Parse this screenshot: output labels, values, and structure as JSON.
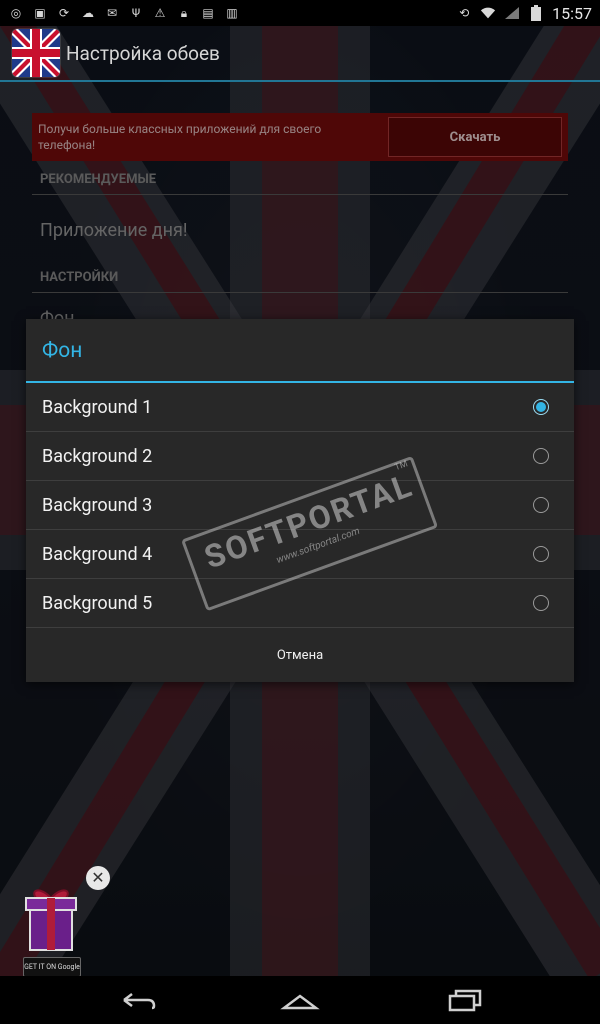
{
  "status_bar": {
    "time": "15:57",
    "icons": [
      "gear-ring-icon",
      "image-icon",
      "sync-icon",
      "cloud-upload-icon",
      "mail-icon",
      "usb-icon",
      "warning-icon",
      "lock-icon",
      "briefcase-icon",
      "sd-card-icon"
    ],
    "right_icons": [
      "rotation-icon",
      "wifi-icon",
      "signal-icon",
      "battery-icon"
    ]
  },
  "action_bar": {
    "title": "Настройка обоев",
    "accent": "#33b5e5"
  },
  "ad_banner": {
    "text": "Получи больше классных приложений для своего телефона!",
    "button_label": "Скачать"
  },
  "settings": {
    "section_recommended": "РЕКОМЕНДУЕМЫЕ",
    "app_of_day": "Приложение дня!",
    "section_settings": "НАСТРОЙКИ",
    "background_item": "Фон"
  },
  "dialog": {
    "title": "Фон",
    "options": [
      {
        "label": "Background 1",
        "selected": true
      },
      {
        "label": "Background 2",
        "selected": false
      },
      {
        "label": "Background 3",
        "selected": false
      },
      {
        "label": "Background 4",
        "selected": false
      },
      {
        "label": "Background 5",
        "selected": false
      }
    ],
    "cancel_label": "Отмена"
  },
  "watermark": {
    "brand": "SOFTPORTAL",
    "tm": "TM",
    "url": "www.softportal.com"
  },
  "gift_ad": {
    "badge": "GET IT ON Google play"
  }
}
